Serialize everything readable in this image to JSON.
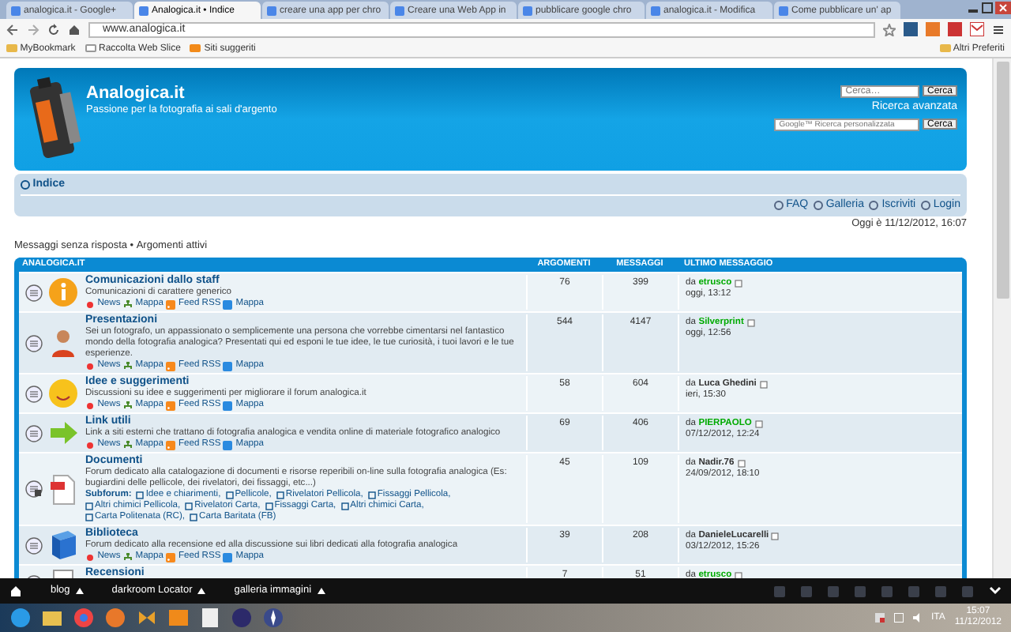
{
  "browser": {
    "tabs": [
      {
        "title": "analogica.it - Google+",
        "selected": false
      },
      {
        "title": "Analogica.it • Indice",
        "selected": true
      },
      {
        "title": "creare una app per chro",
        "selected": false
      },
      {
        "title": "Creare una Web App in",
        "selected": false
      },
      {
        "title": "pubblicare google chro",
        "selected": false
      },
      {
        "title": "analogica.it - Modifica",
        "selected": false
      },
      {
        "title": "Come pubblicare un' ap",
        "selected": false
      }
    ],
    "address": "www.analogica.it",
    "bookmarks": [
      "MyBookmark",
      "Raccolta Web Slice",
      "Siti suggeriti"
    ],
    "other_bookmarks": "Altri Preferiti"
  },
  "header": {
    "site_title": "Analogica.it",
    "tagline": "Passione per la fotografia ai sali d'argento",
    "search": {
      "placeholder": "Cerca…",
      "button": "Cerca"
    },
    "advanced_search": "Ricerca avanzata",
    "google_search": {
      "placeholder": "Google™ Ricerca personalizzata",
      "button": "Cerca"
    }
  },
  "navbar": {
    "breadcrumb": "Indice",
    "links": [
      "FAQ",
      "Galleria",
      "Iscriviti",
      "Login"
    ]
  },
  "current_time": "Oggi è 11/12/2012, 16:07",
  "quick_links": {
    "items": [
      "Messaggi senza risposta",
      "Argomenti attivi"
    ],
    "separator": "•"
  },
  "forum": {
    "columns": [
      "ANALOGICA.IT",
      "ARGOMENTI",
      "MESSAGGI",
      "ULTIMO MESSAGGIO"
    ],
    "rows": [
      {
        "title": "Comunicazioni dallo staff",
        "description": "Comunicazioni di carattere generico",
        "links": [
          "News",
          "Mappa",
          "Feed RSS",
          "Mappa"
        ],
        "topics": "76",
        "posts": "399",
        "last_post": {
          "prefix": "da",
          "author": "etrusco",
          "color": "#00aa00",
          "date": "oggi, 13:12"
        }
      },
      {
        "title": "Presentazioni",
        "description": "Sei un fotografo, un appassionato o semplicemente una persona che vorrebbe cimentarsi nel fantastico mondo della fotografia analogica? Presentati qui ed esponi le tue idee, le tue curiosità, i tuoi lavori e le tue esperienze.",
        "links": [
          "News",
          "Mappa",
          "Feed RSS",
          "Mappa"
        ],
        "topics": "544",
        "posts": "4147",
        "last_post": {
          "prefix": "da",
          "author": "Silverprint",
          "color": "#00aa00",
          "date": "oggi, 12:56"
        }
      },
      {
        "title": "Idee e suggerimenti",
        "description": "Discussioni su idee e suggerimenti per migliorare il forum analogica.it",
        "links": [
          "News",
          "Mappa",
          "Feed RSS",
          "Mappa"
        ],
        "topics": "58",
        "posts": "604",
        "last_post": {
          "prefix": "da",
          "author": "Luca Ghedini",
          "color": "#333333",
          "date": "ieri, 15:30"
        }
      },
      {
        "title": "Link utili",
        "description": "Link a siti esterni che trattano di fotografia analogica e vendita online di materiale fotografico analogico",
        "links": [
          "News",
          "Mappa",
          "Feed RSS",
          "Mappa"
        ],
        "topics": "69",
        "posts": "406",
        "last_post": {
          "prefix": "da",
          "author": "PIERPAOLO",
          "color": "#00aa00",
          "date": "07/12/2012, 12:24"
        }
      },
      {
        "title": "Documenti",
        "description": "Forum dedicato alla catalogazione di documenti e risorse reperibili on-line sulla fotografia analogica (Es: bugiardini delle pellicole, dei rivelatori, dei fissaggi, etc...)",
        "subforum_label": "Subforum:",
        "subforums": [
          "Idee e chiarimenti,",
          "Pellicole,",
          "Rivelatori Pellicola,",
          "Fissaggi Pellicola,",
          "Altri chimici Pellicola,",
          "Rivelatori Carta,",
          "Fissaggi Carta,",
          "Altri chimici Carta,",
          "Carta Politenata (RC),",
          "Carta Baritata (FB)"
        ],
        "topics": "45",
        "posts": "109",
        "last_post": {
          "prefix": "da",
          "author": "Nadir.76",
          "color": "#333333",
          "date": "24/09/2012, 18:10"
        }
      },
      {
        "title": "Biblioteca",
        "description": "Forum dedicato alla recensione ed alla discussione sui libri dedicati alla fotografia analogica",
        "links": [
          "News",
          "Mappa",
          "Feed RSS",
          "Mappa"
        ],
        "topics": "39",
        "posts": "208",
        "last_post": {
          "prefix": "da",
          "author": "DanieleLucarelli",
          "color": "#333333",
          "date": "03/12/2012, 15:26"
        }
      },
      {
        "title": "Recensioni",
        "topics": "7",
        "posts": "51",
        "last_post": {
          "prefix": "da",
          "author": "etrusco",
          "color": "#00aa00"
        }
      }
    ]
  },
  "bottom_toolbar": {
    "items": [
      "blog",
      "darkroom Locator",
      "galleria immagini"
    ]
  },
  "taskbar": {
    "language": "ITA",
    "time": "15:07",
    "date": "11/12/2012"
  }
}
